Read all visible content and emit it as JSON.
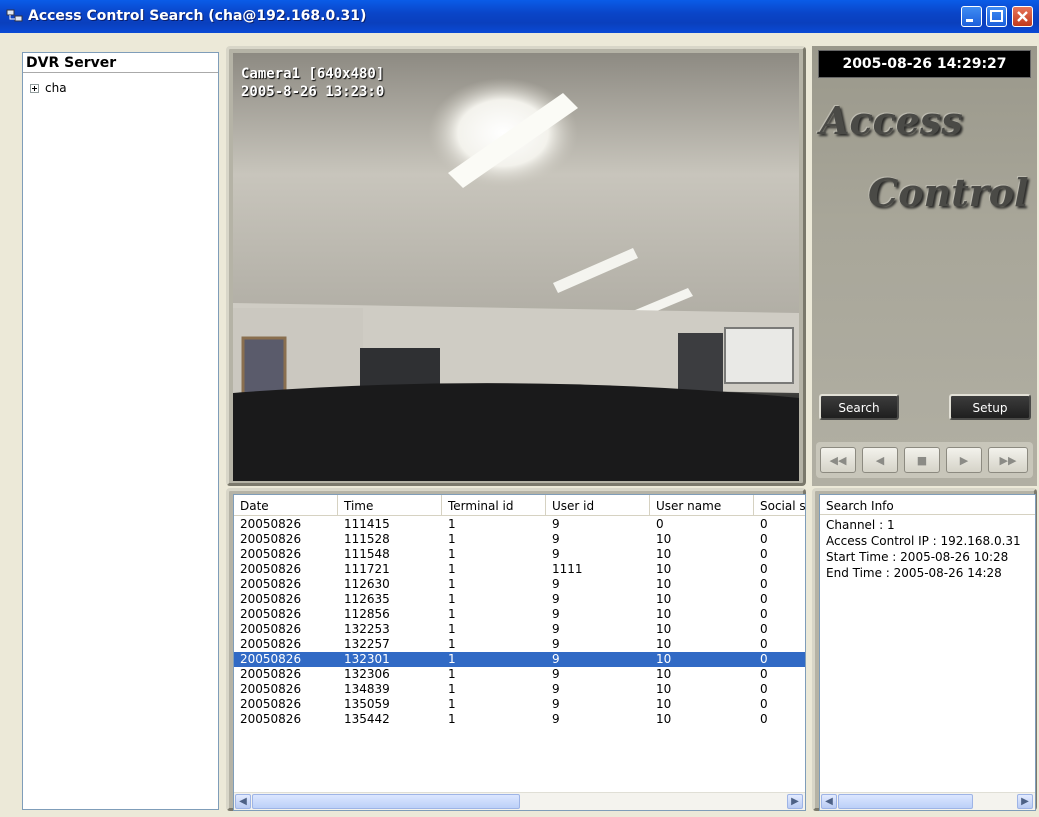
{
  "window": {
    "title": "Access Control Search (cha@192.168.0.31)"
  },
  "tree": {
    "header": "DVR Server",
    "nodes": [
      {
        "label": "cha"
      }
    ]
  },
  "video": {
    "camera_label": "Camera1 [640x480]",
    "timestamp": "2005-8-26 13:23:0"
  },
  "control": {
    "clock": "2005-08-26 14:29:27",
    "logo_line1": "Access",
    "logo_line2": "Control",
    "search_label": "Search",
    "setup_label": "Setup",
    "transport": {
      "rewind": "◀◀",
      "back": "◀",
      "stop": "■",
      "play": "▶",
      "forward": "▶▶"
    }
  },
  "events": {
    "columns": [
      "Date",
      "Time",
      "Terminal id",
      "User id",
      "User name",
      "Social s"
    ],
    "rows": [
      [
        "20050826",
        "111415",
        "1",
        "9",
        "0",
        "0"
      ],
      [
        "20050826",
        "111528",
        "1",
        "9",
        "10",
        "0"
      ],
      [
        "20050826",
        "111548",
        "1",
        "9",
        "10",
        "0"
      ],
      [
        "20050826",
        "111721",
        "1",
        "1111",
        "10",
        "0"
      ],
      [
        "20050826",
        "112630",
        "1",
        "9",
        "10",
        "0"
      ],
      [
        "20050826",
        "112635",
        "1",
        "9",
        "10",
        "0"
      ],
      [
        "20050826",
        "112856",
        "1",
        "9",
        "10",
        "0"
      ],
      [
        "20050826",
        "132253",
        "1",
        "9",
        "10",
        "0"
      ],
      [
        "20050826",
        "132257",
        "1",
        "9",
        "10",
        "0"
      ],
      [
        "20050826",
        "132301",
        "1",
        "9",
        "10",
        "0"
      ],
      [
        "20050826",
        "132306",
        "1",
        "9",
        "10",
        "0"
      ],
      [
        "20050826",
        "134839",
        "1",
        "9",
        "10",
        "0"
      ],
      [
        "20050826",
        "135059",
        "1",
        "9",
        "10",
        "0"
      ],
      [
        "20050826",
        "135442",
        "1",
        "9",
        "10",
        "0"
      ]
    ],
    "selected_row": 9
  },
  "search_info": {
    "header": "Search Info",
    "lines": [
      "Channel : 1",
      "Access Control IP : 192.168.0.31",
      "Start Time : 2005-08-26 10:28",
      "End Time : 2005-08-26 14:28"
    ]
  },
  "colors": {
    "titlebar": "#0a4ad6",
    "selection": "#316ac5",
    "panel": "#ece9d8"
  }
}
